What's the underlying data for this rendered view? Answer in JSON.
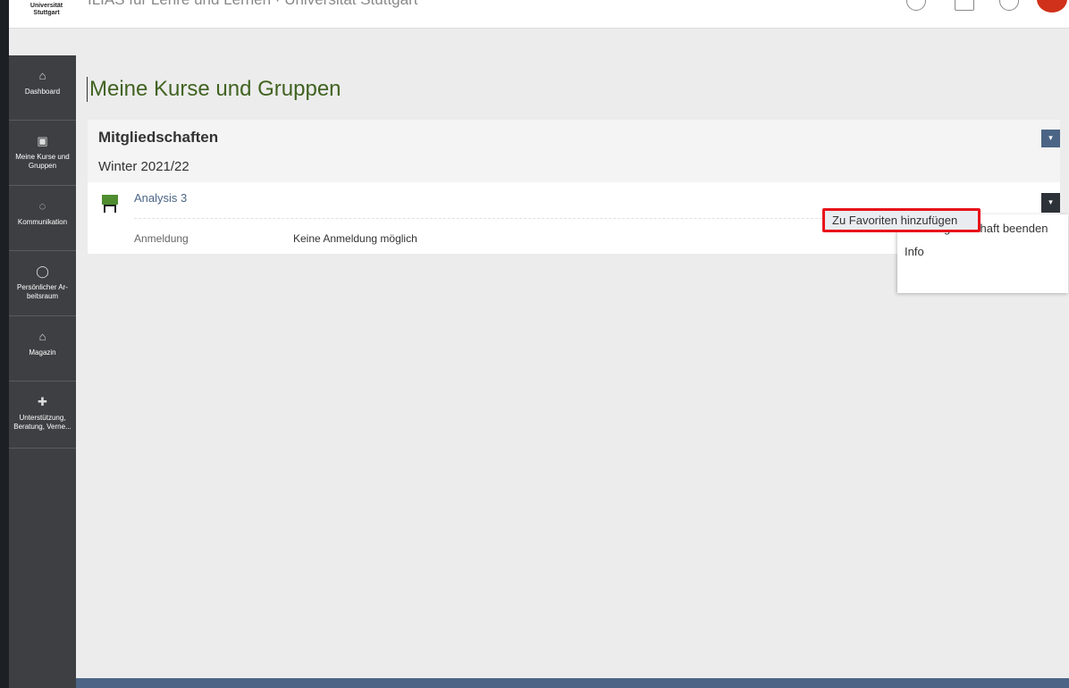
{
  "header": {
    "logo_line1": "Universität",
    "logo_line2": "Stuttgart",
    "title": "ILIAS für Lehre und Lernen · Universität Stuttgart"
  },
  "sidebar": {
    "items": [
      {
        "label": "Dashboard",
        "icon": "dashboard-icon"
      },
      {
        "label": "Meine Kurse und Gruppen",
        "icon": "courses-icon"
      },
      {
        "label": "Kommunikation",
        "icon": "communication-icon"
      },
      {
        "label": "Persönlicher Ar-beitsraum",
        "icon": "workspace-icon"
      },
      {
        "label": "Magazin",
        "icon": "repository-icon"
      },
      {
        "label": "Unterstützung, Beratung, Verne...",
        "icon": "handshake-icon"
      }
    ]
  },
  "main": {
    "page_title": "Meine Kurse und Gruppen",
    "panel": {
      "title": "Mitgliedschaften",
      "semester": "Winter 2021/22",
      "dropdown_icon": "▾",
      "course": {
        "name": "Analysis 3",
        "prop_label": "Anmeldung",
        "prop_value": "Keine Anmeldung möglich",
        "dropdown_icon": "▾"
      }
    },
    "action_menu": {
      "items": [
        "Kursmitgliedschaft beenden",
        "Info",
        "Zu Favoriten hinzufügen"
      ],
      "highlighted_index": 2,
      "highlight_color": "#e8121a"
    }
  },
  "colors": {
    "sidebar_bg": "#3d3f42",
    "title_green": "#416322",
    "link_blue": "#4c6586"
  }
}
